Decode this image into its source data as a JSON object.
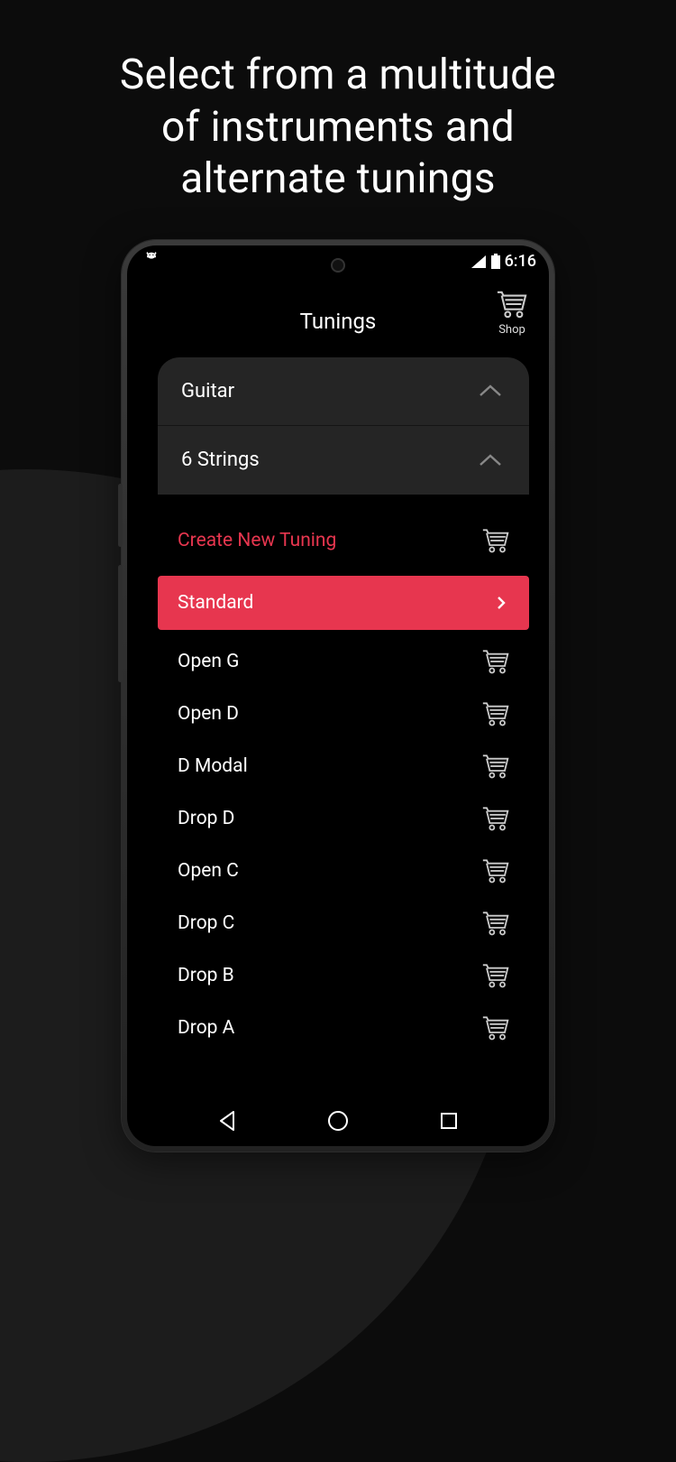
{
  "marketing": {
    "line1": "Select from a multitude",
    "line2": "of instruments and",
    "line3": "alternate tunings"
  },
  "status": {
    "time": "6:16"
  },
  "header": {
    "title": "Tunings",
    "shop_label": "Shop"
  },
  "dropdowns": {
    "instrument": "Guitar",
    "strings": "6 Strings"
  },
  "create_label": "Create New Tuning",
  "selected_tuning": "Standard",
  "tunings": [
    "Open G",
    "Open D",
    "D Modal",
    "Drop D",
    "Open C",
    "Drop C",
    "Drop B",
    "Drop A"
  ],
  "colors": {
    "accent": "#e7364f"
  }
}
